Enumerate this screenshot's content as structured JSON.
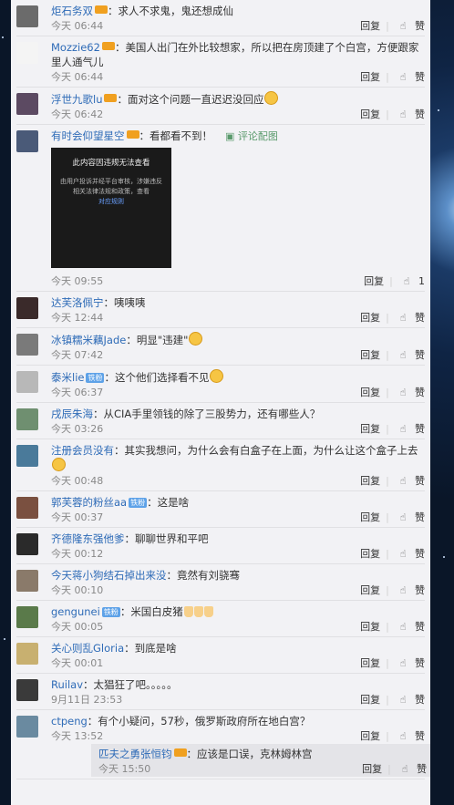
{
  "comments": [
    {
      "user": "炬石务双",
      "badge": "vip",
      "badge_text": "",
      "text": "求人不求鬼，鬼还想成仙",
      "time": "今天 06:44",
      "reply_label": "回复",
      "like_label": "赞",
      "avatar_color": "#6b6b6b"
    },
    {
      "user": "Mozzie62",
      "badge": "vip",
      "badge_text": "",
      "text": "美国人出门在外比较想家，所以把在房顶建了个白宫，方便跟家里人通气儿",
      "time": "今天 06:44",
      "reply_label": "回复",
      "like_label": "赞",
      "avatar_color": "#f4f4f4"
    },
    {
      "user": "浮世九歌lu",
      "badge": "vip",
      "badge_text": "",
      "text": "面对这个问题一直迟迟没回应",
      "time": "今天 06:42",
      "reply_label": "回复",
      "like_label": "赞",
      "avatar_color": "#5c4a62"
    },
    {
      "user": "有时会仰望星空",
      "badge": "vip",
      "badge_text": "",
      "text": "看都看不到！",
      "pic_link": "评论配图",
      "time": "今天 09:55",
      "reply_label": "回复",
      "like_label": "1",
      "avatar_color": "#4a5a78",
      "blocked": {
        "title": "此内容因违规无法查看",
        "body": "由用户投诉并经平台审核，涉嫌违反相关法律法规和政策，查看",
        "link": "对应规则"
      }
    },
    {
      "user": "达芙洛佩宁",
      "badge": "",
      "badge_text": "",
      "text": "咦咦咦",
      "time": "今天 12:44",
      "reply_label": "回复",
      "like_label": "赞",
      "avatar_color": "#3a2a2a"
    },
    {
      "user": "冰镇糯米藕Jade",
      "badge": "",
      "badge_text": "",
      "text": "明显\"违建\"",
      "time": "今天 07:42",
      "reply_label": "回复",
      "like_label": "赞",
      "avatar_color": "#7a7a7a"
    },
    {
      "user": "泰米lie",
      "badge": "fan",
      "badge_text": "铁粉",
      "text": "这个他们选择看不见",
      "time": "今天 06:37",
      "reply_label": "回复",
      "like_label": "赞",
      "avatar_color": "#b8b8b8"
    },
    {
      "user": "戌辰朱海",
      "badge": "",
      "badge_text": "",
      "text": "从CIA手里领钱的除了三股势力，还有哪些人？",
      "time": "今天 03:26",
      "reply_label": "回复",
      "like_label": "赞",
      "avatar_color": "#6f8f70"
    },
    {
      "user": "注册会员没有",
      "badge": "",
      "badge_text": "",
      "text": "其实我想问，为什么会有白盒子在上面，为什么让这个盒子上去",
      "time": "今天 00:48",
      "reply_label": "回复",
      "like_label": "赞",
      "avatar_color": "#4a7a9a"
    },
    {
      "user": "郭芙蓉的粉丝aa",
      "badge": "fan",
      "badge_text": "铁粉",
      "text": "这是啥",
      "time": "今天 00:37",
      "reply_label": "回复",
      "like_label": "赞",
      "avatar_color": "#7a5040"
    },
    {
      "user": "齐德隆东强他爹",
      "badge": "",
      "badge_text": "",
      "text": "聊聊世界和平吧",
      "time": "今天 00:12",
      "reply_label": "回复",
      "like_label": "赞",
      "avatar_color": "#2a2a2a"
    },
    {
      "user": "今天蒋小狗结石掉出来没",
      "badge": "",
      "badge_text": "",
      "text": "竟然有刘骁骞",
      "time": "今天 00:10",
      "reply_label": "回复",
      "like_label": "赞",
      "avatar_color": "#8a7a6a"
    },
    {
      "user": "gengunei",
      "badge": "fan",
      "badge_text": "铁粉",
      "text": "米国白皮猪",
      "time": "今天 00:05",
      "reply_label": "回复",
      "like_label": "赞",
      "avatar_color": "#5a7a4a"
    },
    {
      "user": "关心则乱Gloria",
      "badge": "",
      "badge_text": "",
      "text": "到底是啥",
      "time": "今天 00:01",
      "reply_label": "回复",
      "like_label": "赞",
      "avatar_color": "#c8b070"
    },
    {
      "user": "Ruilav",
      "badge": "",
      "badge_text": "",
      "text": "太猖狂了吧。。。。。",
      "time": "9月11日 23:53",
      "reply_label": "回复",
      "like_label": "赞",
      "avatar_color": "#3a3a3a"
    },
    {
      "user": "ctpeng",
      "badge": "",
      "badge_text": "",
      "text": "有个小疑问，57秒，俄罗斯政府所在地白宫？",
      "time": "今天 13:52",
      "reply_label": "回复",
      "like_label": "赞",
      "avatar_color": "#6a8aa0",
      "reply": {
        "user": "匹夫之勇张恒钧",
        "text": "应该是口误，克林姆林宫",
        "time": "今天 15:50",
        "reply_label": "回复",
        "like_label": "赞"
      }
    }
  ]
}
